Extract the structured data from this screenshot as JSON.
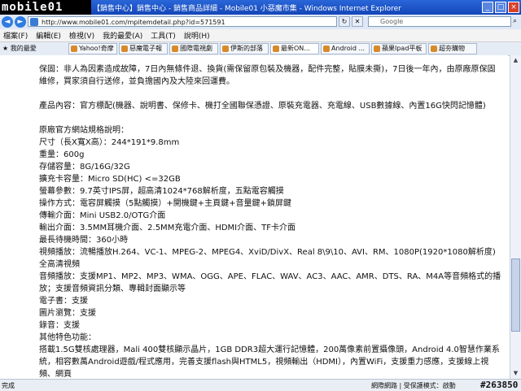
{
  "window": {
    "logo": "mobile01",
    "title": "【銷售中心】銷售中心 - 銷售商品詳細 - Mobile01 小惡魔市集 - Windows Internet Explorer"
  },
  "address": {
    "url": "http://www.mobile01.com/mpitemdetail.php?id=571591",
    "search_placeholder": "Google"
  },
  "menu": [
    "檔案(F)",
    "編輯(E)",
    "檢視(V)",
    "我的最愛(A)",
    "工具(T)",
    "說明(H)"
  ],
  "favorites_label": "我的最愛",
  "tabs": [
    {
      "label": "Yahoo!奇摩"
    },
    {
      "label": "惡魔電子報"
    },
    {
      "label": "國際電視劇"
    },
    {
      "label": "伊斯的部落"
    },
    {
      "label": "最新ON...",
      "active": true
    },
    {
      "label": "Android ..."
    },
    {
      "label": "蘋果Ipad平板"
    },
    {
      "label": "超夯購物"
    }
  ],
  "content": {
    "paragraphs": [
      "保固：非人為因素造成故障，7日內無條件退、換貨(需保留原包裝及機器，配件完整，貼膜未撕)，7日後一年內，由原廠原保固維修，買家須自行送修，並負擔國內及大陸來回運費。",
      "",
      "產品內容：官方標配(機器、說明書、保修卡、機打全國聯保憑證、原裝充電器、充電線、USB數據線、內置16G快閃記憶體)",
      "",
      "原廠官方網站規格說明：",
      "尺寸（長X寬X高）：244*191*9.8mm",
      "重量：600g",
      "存儲容量：8G/16G/32G",
      "擴充卡容量：Micro SD(HC) <=32GB",
      "螢幕參數：9.7英寸IPS屏，超高清1024*768解析度，五點電容觸摸",
      "操作方式：電容屏觸摸（5點觸摸）+開機鍵+主頁鍵+音量鍵+鎖屏鍵",
      "傳輸介面：Mini USB2.0/OTG介面",
      "輸出介面：3.5MM耳機介面、2.5MM充電介面、HDMI介面、TF卡介面",
      "最長待機時間：360小時",
      "視頻播放：流暢播放H.264、VC-1、MPEG-2、MPEG4、XviD/DivX、Real 8\\9\\10、AVI、RM、1080P(1920*1080解析度)全高清視頻",
      "音頻播放：支援MP1、MP2、MP3、WMA、OGG、APE、FLAC、WAV、AC3、AAC、AMR、DTS、RA、M4A等音頻格式的播放；支援音頻資訊分類、專輯封面顯示等",
      "電子書：支援",
      "圖片瀏覽：支援",
      "錄音：支援",
      "其他特色功能：",
      "搭載1.5G雙核處理器，Mali 400雙核顯示晶片，1GB DDR3超大運行記憶體，200萬像素前置攝像頭，Android 4.0智慧作業系統，相容數萬Android遊戲/程式應用，完善支援flash與HTML5，視頻輸出（HDMI），內置WiFi，支援重力感應，支援線上視頻、網頁"
    ]
  },
  "status": {
    "left": "完成",
    "zone": "網際網路 | 受保護模式：啟動",
    "id": "#263850"
  }
}
